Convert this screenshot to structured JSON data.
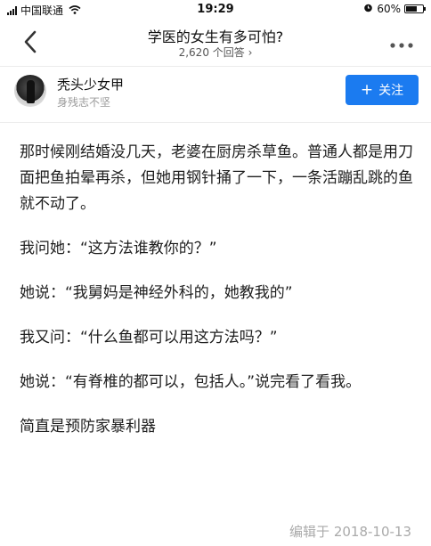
{
  "status_bar": {
    "carrier": "中国联通",
    "time": "19:29",
    "battery": "60%"
  },
  "nav": {
    "title": "学医的女生有多可怕?",
    "subtitle": "2,620 个回答 ›"
  },
  "author": {
    "name": "秃头少女甲",
    "bio": "身残志不坚",
    "follow_label": "关注"
  },
  "answer": {
    "paragraphs": [
      "那时候刚结婚没几天，老婆在厨房杀草鱼。普通人都是用刀面把鱼拍晕再杀，但她用钢针捅了一下，一条活蹦乱跳的鱼就不动了。",
      "我问她：“这方法谁教你的？”",
      "她说：“我舅妈是神经外科的，她教我的”",
      "我又问：“什么鱼都可以用这方法吗？”",
      "她说：“有脊椎的都可以，包括人。”说完看了看我。",
      "简直是预防家暴利器"
    ],
    "edited": "编辑于 2018-10-13"
  }
}
